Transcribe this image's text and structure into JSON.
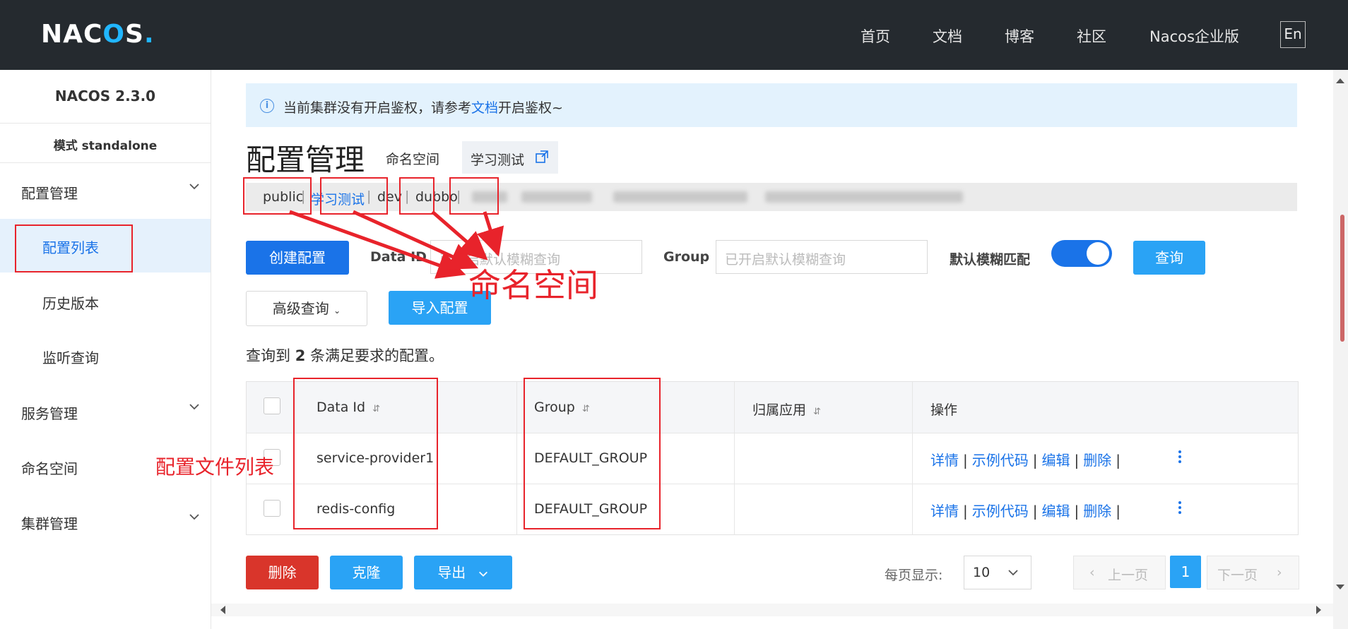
{
  "header": {
    "logo": "NAC",
    "logo_o": "O",
    "logo_s": "S",
    "logo_dot": ".",
    "nav": [
      "首页",
      "文档",
      "博客",
      "社区",
      "Nacos企业版"
    ],
    "lang": "En"
  },
  "sidebar": {
    "version": "NACOS 2.3.0",
    "mode": "模式 standalone",
    "items": [
      {
        "label": "配置管理",
        "expandable": true
      },
      {
        "label": "配置列表",
        "active": true
      },
      {
        "label": "历史版本"
      },
      {
        "label": "监听查询"
      },
      {
        "label": "服务管理",
        "expandable": true
      },
      {
        "label": "命名空间"
      },
      {
        "label": "集群管理",
        "expandable": true
      }
    ]
  },
  "notice": {
    "text_before": "当前集群没有开启鉴权，请参考",
    "link": "文档",
    "text_after": "开启鉴权~"
  },
  "page": {
    "title": "配置管理",
    "namespace_label": "命名空间",
    "namespace_value": "学习测试"
  },
  "namespace_tabs": [
    "public",
    "学习测试",
    "dev",
    "dubbo"
  ],
  "toolbar": {
    "create_label": "创建配置",
    "data_id_label": "Data ID",
    "data_id_placeholder": "已开启默认模糊查询",
    "group_label": "Group",
    "group_placeholder": "已开启默认模糊查询",
    "fuzzy_label": "默认模糊匹配",
    "fuzzy_on": true,
    "query_label": "查询",
    "advanced_label": "高级查询",
    "import_label": "导入配置"
  },
  "result": {
    "prefix": "查询到",
    "count": "2",
    "suffix": "条满足要求的配置。"
  },
  "table": {
    "columns": [
      "Data Id",
      "Group",
      "归属应用",
      "操作"
    ],
    "sort_icon": "⇵",
    "rows": [
      {
        "data_id": "service-provider1",
        "group": "DEFAULT_GROUP",
        "app": ""
      },
      {
        "data_id": "redis-config",
        "group": "DEFAULT_GROUP",
        "app": ""
      }
    ],
    "actions": [
      "详情",
      "示例代码",
      "编辑",
      "删除"
    ],
    "action_sep": "|"
  },
  "footer": {
    "delete_label": "删除",
    "clone_label": "克隆",
    "export_label": "导出",
    "page_size_label": "每页显示:",
    "page_size": "10",
    "prev_label": "上一页",
    "next_label": "下一页",
    "current_page": "1"
  },
  "annotations": {
    "namespace_note": "命名空间",
    "config_list_note": "配置文件列表"
  },
  "colors": {
    "header_bg": "#252a2f",
    "primary": "#1a73e8",
    "light_primary": "#2aa3f5",
    "danger": "#d9352b",
    "annotation_red": "#e8232b"
  }
}
